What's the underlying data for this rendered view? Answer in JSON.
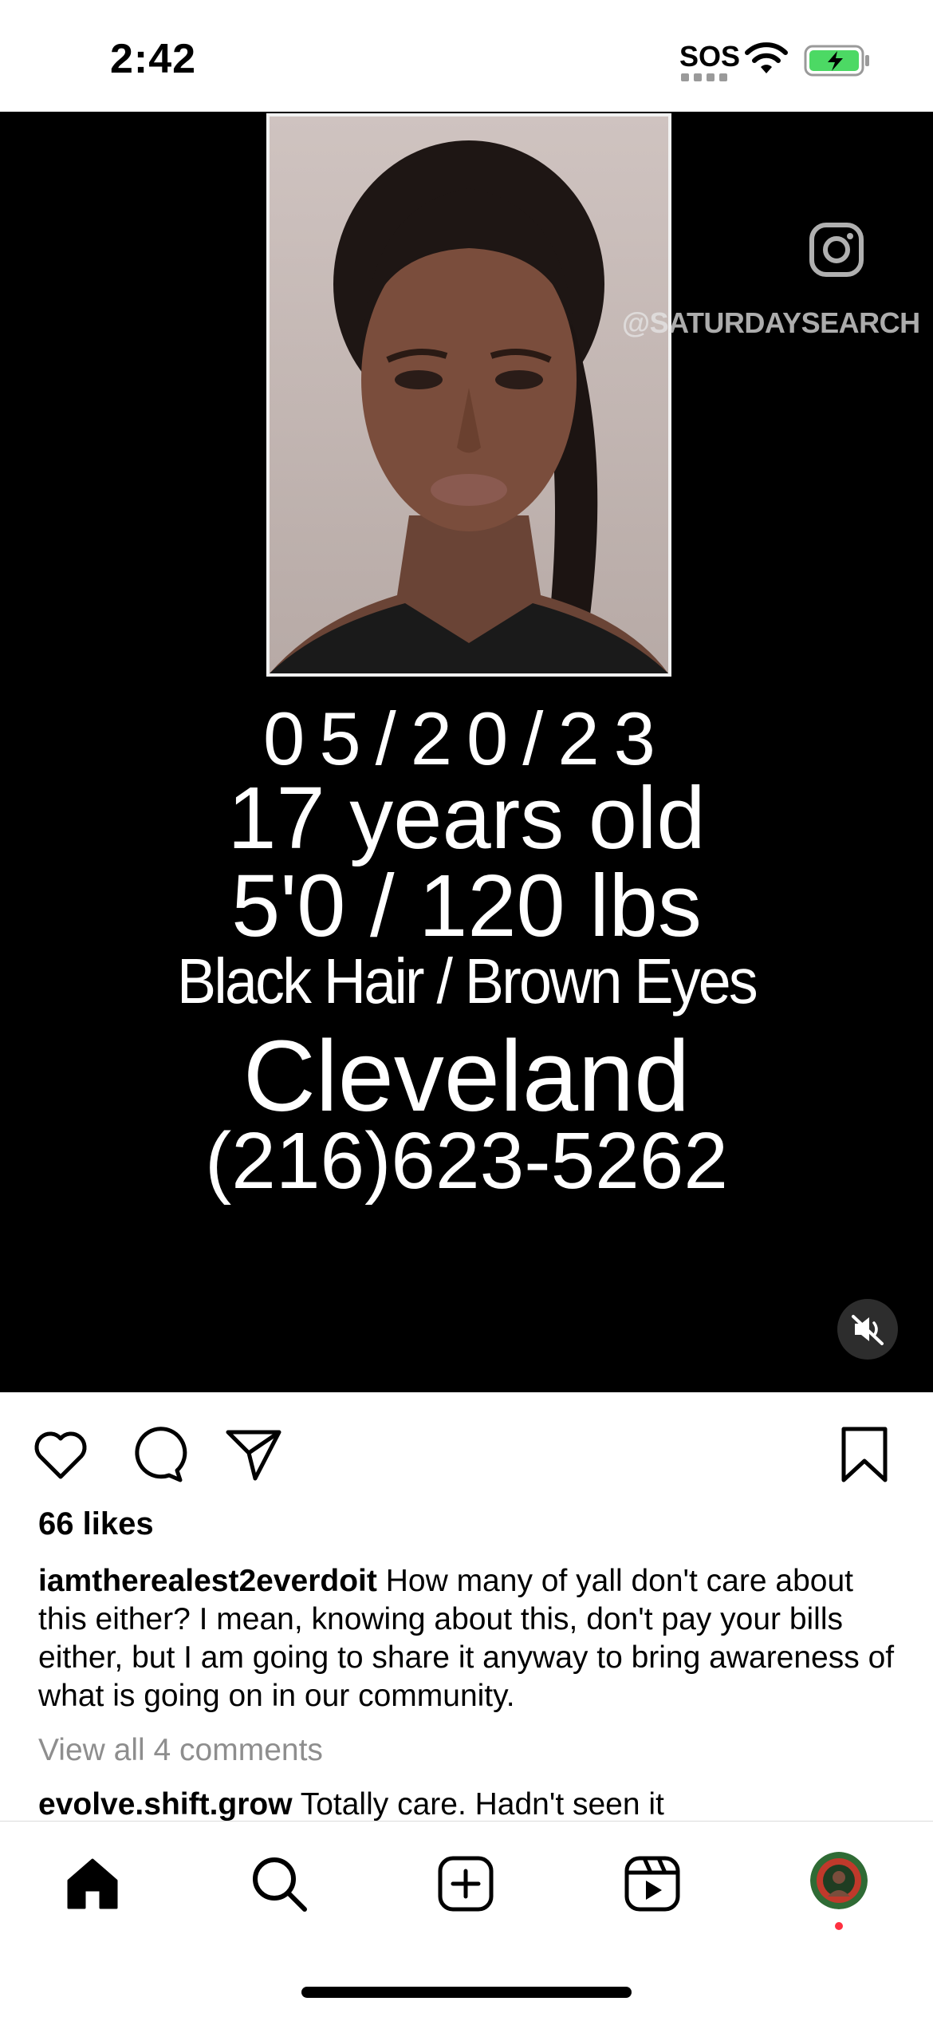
{
  "status_bar": {
    "time": "2:42",
    "sos": "SOS",
    "icons": [
      "wifi-icon",
      "battery-charging-icon"
    ]
  },
  "video": {
    "watermark": "@SATURDAYSEARCH",
    "overlay_lines": {
      "date": "05/20/23",
      "age": "17 years old",
      "size": "5'0 / 120 lbs",
      "hair_eyes": "Black Hair / Brown Eyes",
      "city": "Cleveland",
      "phone": "(216)623-5262"
    },
    "mute_icon": "speaker-muted-icon"
  },
  "post": {
    "likes": "66 likes",
    "caption_user": "iamtherealest2everdoit",
    "caption_text": "How many of yall don't care about this either? I mean, knowing about this, don't pay your bills either, but I am going to share it anyway to bring awareness of what is going on in our community.",
    "view_comments": "View all 4 comments",
    "comment_user": "evolve.shift.grow",
    "comment_text": "Totally care. Hadn't seen it"
  },
  "actions": [
    "heart-icon",
    "comment-icon",
    "share-icon",
    "bookmark-icon"
  ],
  "bottom_nav": [
    "home-icon",
    "search-icon",
    "create-icon",
    "reels-icon",
    "profile-avatar"
  ],
  "colors": {
    "video_bg": "#000000",
    "notification_dot": "#ff3040",
    "battery_fill": "#4cd964",
    "muted_text": "#8e8e8e"
  }
}
